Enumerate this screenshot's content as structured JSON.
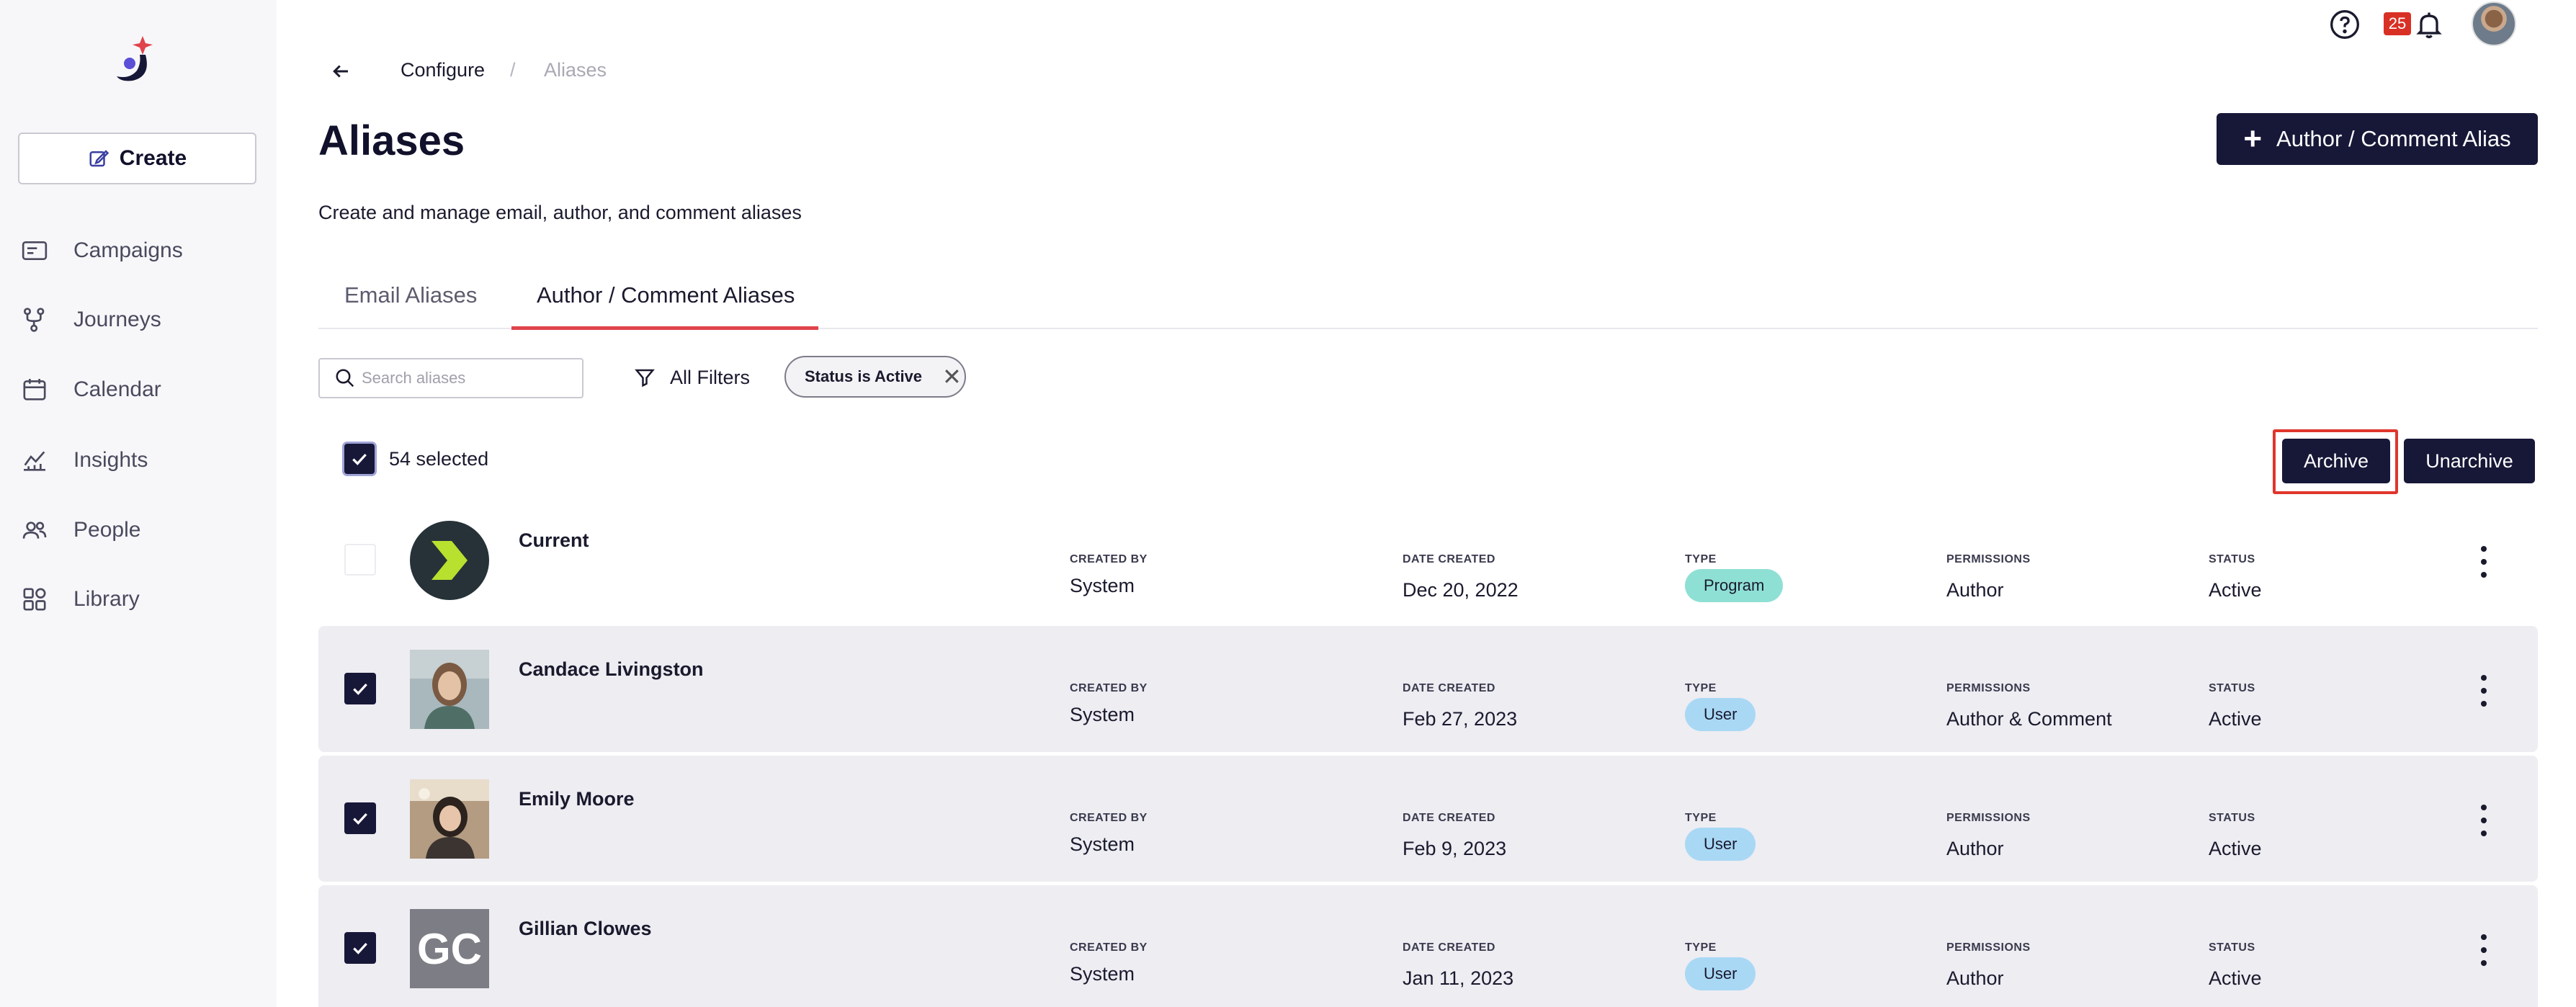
{
  "sidebar": {
    "create_label": "Create",
    "items": [
      {
        "label": "Campaigns",
        "icon": "campaigns-icon"
      },
      {
        "label": "Journeys",
        "icon": "journeys-icon"
      },
      {
        "label": "Calendar",
        "icon": "calendar-icon"
      },
      {
        "label": "Insights",
        "icon": "insights-icon"
      },
      {
        "label": "People",
        "icon": "people-icon"
      },
      {
        "label": "Library",
        "icon": "library-icon"
      }
    ]
  },
  "topbar": {
    "notification_count": "25"
  },
  "breadcrumb": {
    "parent": "Configure",
    "separator": "/",
    "current": "Aliases"
  },
  "page": {
    "title": "Aliases",
    "subtitle": "Create and manage email, author, and comment aliases",
    "add_button_label": "Author / Comment Alias"
  },
  "tabs": [
    {
      "label": "Email Aliases",
      "active": false
    },
    {
      "label": "Author / Comment Aliases",
      "active": true
    }
  ],
  "filters": {
    "search_placeholder": "Search aliases",
    "all_filters_label": "All Filters",
    "chip_label": "Status is Active"
  },
  "selection": {
    "count_label": "54 selected",
    "archive_label": "Archive",
    "unarchive_label": "Unarchive"
  },
  "columns": {
    "created_by": "CREATED BY",
    "date_created": "DATE CREATED",
    "type": "TYPE",
    "permissions": "PERMISSIONS",
    "status": "STATUS"
  },
  "rows": [
    {
      "name": "Current",
      "created_by": "System",
      "date_created": "Dec 20, 2022",
      "type": "Program",
      "permissions": "Author",
      "status": "Active",
      "selected": false
    },
    {
      "name": "Candace Livingston",
      "created_by": "System",
      "date_created": "Feb 27, 2023",
      "type": "User",
      "permissions": "Author & Comment",
      "status": "Active",
      "selected": true
    },
    {
      "name": "Emily Moore",
      "created_by": "System",
      "date_created": "Feb 9, 2023",
      "type": "User",
      "permissions": "Author",
      "status": "Active",
      "selected": true
    },
    {
      "name": "Gillian Clowes",
      "created_by": "System",
      "date_created": "Jan 11, 2023",
      "type": "User",
      "permissions": "Author",
      "status": "Active",
      "selected": true,
      "initials": "GC"
    }
  ],
  "colors": {
    "primary_dark": "#171738",
    "tab_accent": "#e0434b",
    "program_pill": "#8fe0d4",
    "user_pill": "#a9d8f5",
    "highlight_red": "#e0362c"
  }
}
